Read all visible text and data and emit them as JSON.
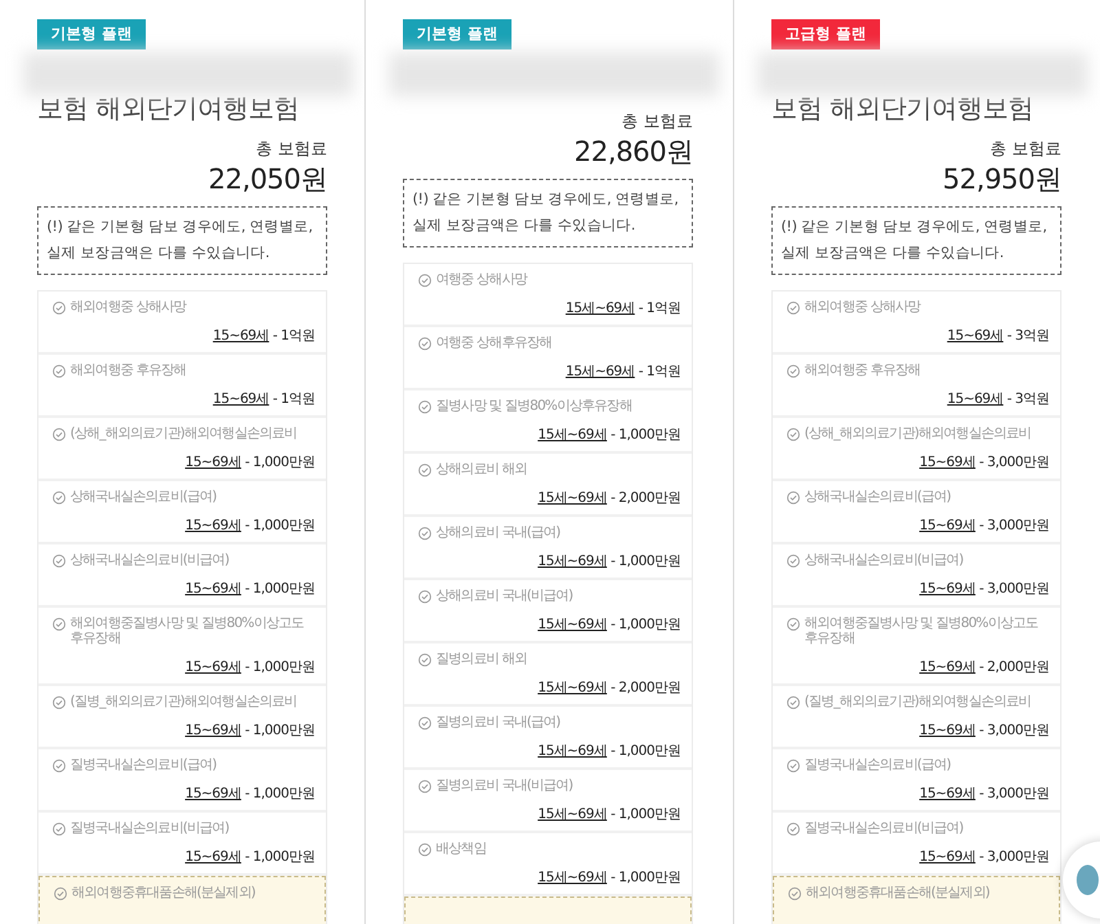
{
  "plans": [
    {
      "badge": {
        "label": "기본형 플랜",
        "kind": "basic"
      },
      "title": "보험 해외단기여행보험",
      "premium_label": "총 보험료",
      "premium": "22,050원",
      "notice": "(!) 같은 기본형 담보 경우에도, 연령별로, 실제 보장금액은 다를 수있습니다.",
      "coverages": [
        {
          "name": "해외여행중 상해사망",
          "age": "15~69세",
          "amount": " - 1억원",
          "highlighted": false
        },
        {
          "name": "해외여행중 후유장해",
          "age": "15~69세",
          "amount": " - 1억원",
          "highlighted": false
        },
        {
          "name": "(상해_해외의료기관)해외여행실손의료비",
          "age": "15~69세",
          "amount": " - 1,000만원",
          "highlighted": false
        },
        {
          "name": "상해국내실손의료비(급여)",
          "age": "15~69세",
          "amount": " - 1,000만원",
          "highlighted": false
        },
        {
          "name": "상해국내실손의료비(비급여)",
          "age": "15~69세",
          "amount": " - 1,000만원",
          "highlighted": false
        },
        {
          "name": "해외여행중질병사망 및 질병80%이상고도후유장해",
          "age": "15~69세",
          "amount": " - 1,000만원",
          "highlighted": false
        },
        {
          "name": "(질병_해외의료기관)해외여행실손의료비",
          "age": "15~69세",
          "amount": " - 1,000만원",
          "highlighted": false
        },
        {
          "name": "질병국내실손의료비(급여)",
          "age": "15~69세",
          "amount": " - 1,000만원",
          "highlighted": false
        },
        {
          "name": "질병국내실손의료비(비급여)",
          "age": "15~69세",
          "amount": " - 1,000만원",
          "highlighted": false
        },
        {
          "name": "해외여행중휴대품손해(분실제외)",
          "highlighted": true
        }
      ]
    },
    {
      "badge": {
        "label": "기본형 플랜",
        "kind": "basic"
      },
      "premium_label": "총 보험료",
      "premium": "22,860원",
      "notice": "(!) 같은 기본형 담보 경우에도, 연령별로, 실제 보장금액은 다를 수있습니다.",
      "coverages": [
        {
          "name": "여행중 상해사망",
          "age": "15세~69세",
          "amount": " - 1억원",
          "highlighted": false
        },
        {
          "name": "여행중 상해후유장해",
          "age": "15세~69세",
          "amount": " - 1억원",
          "highlighted": false
        },
        {
          "name": "질병사망 및 질병80%이상후유장해",
          "age": "15세~69세",
          "amount": " - 1,000만원",
          "highlighted": false
        },
        {
          "name": "상해의료비 해외",
          "age": "15세~69세",
          "amount": " - 2,000만원",
          "highlighted": false
        },
        {
          "name": "상해의료비 국내(급여)",
          "age": "15세~69세",
          "amount": " - 1,000만원",
          "highlighted": false
        },
        {
          "name": "상해의료비 국내(비급여)",
          "age": "15세~69세",
          "amount": " - 1,000만원",
          "highlighted": false
        },
        {
          "name": "질병의료비 해외",
          "age": "15세~69세",
          "amount": " - 2,000만원",
          "highlighted": false
        },
        {
          "name": "질병의료비 국내(급여)",
          "age": "15세~69세",
          "amount": " - 1,000만원",
          "highlighted": false
        },
        {
          "name": "질병의료비 국내(비급여)",
          "age": "15세~69세",
          "amount": " - 1,000만원",
          "highlighted": false
        },
        {
          "name": "배상책임",
          "age": "15세~69세",
          "amount": " - 1,000만원",
          "highlighted": false
        },
        {
          "highlighted": true
        }
      ]
    },
    {
      "badge": {
        "label": "고급형 플랜",
        "kind": "premium"
      },
      "title": "보험 해외단기여행보험",
      "premium_label": "총 보험료",
      "premium": "52,950원",
      "notice": "(!) 같은 기본형 담보 경우에도, 연령별로, 실제 보장금액은 다를 수있습니다.",
      "coverages": [
        {
          "name": "해외여행중 상해사망",
          "age": "15~69세",
          "amount": " - 3억원",
          "highlighted": false
        },
        {
          "name": "해외여행중 후유장해",
          "age": "15~69세",
          "amount": " - 3억원",
          "highlighted": false
        },
        {
          "name": "(상해_해외의료기관)해외여행실손의료비",
          "age": "15~69세",
          "amount": " - 3,000만원",
          "highlighted": false
        },
        {
          "name": "상해국내실손의료비(급여)",
          "age": "15~69세",
          "amount": " - 3,000만원",
          "highlighted": false
        },
        {
          "name": "상해국내실손의료비(비급여)",
          "age": "15~69세",
          "amount": " - 3,000만원",
          "highlighted": false
        },
        {
          "name": "해외여행중질병사망 및 질병80%이상고도후유장해",
          "age": "15~69세",
          "amount": " - 2,000만원",
          "highlighted": false
        },
        {
          "name": "(질병_해외의료기관)해외여행실손의료비",
          "age": "15~69세",
          "amount": " - 3,000만원",
          "highlighted": false
        },
        {
          "name": "질병국내실손의료비(급여)",
          "age": "15~69세",
          "amount": " - 3,000만원",
          "highlighted": false
        },
        {
          "name": "질병국내실손의료비(비급여)",
          "age": "15~69세",
          "amount": " - 3,000만원",
          "highlighted": false
        },
        {
          "name": "해외여행중휴대품손해(분실제외)",
          "highlighted": true
        }
      ]
    }
  ]
}
